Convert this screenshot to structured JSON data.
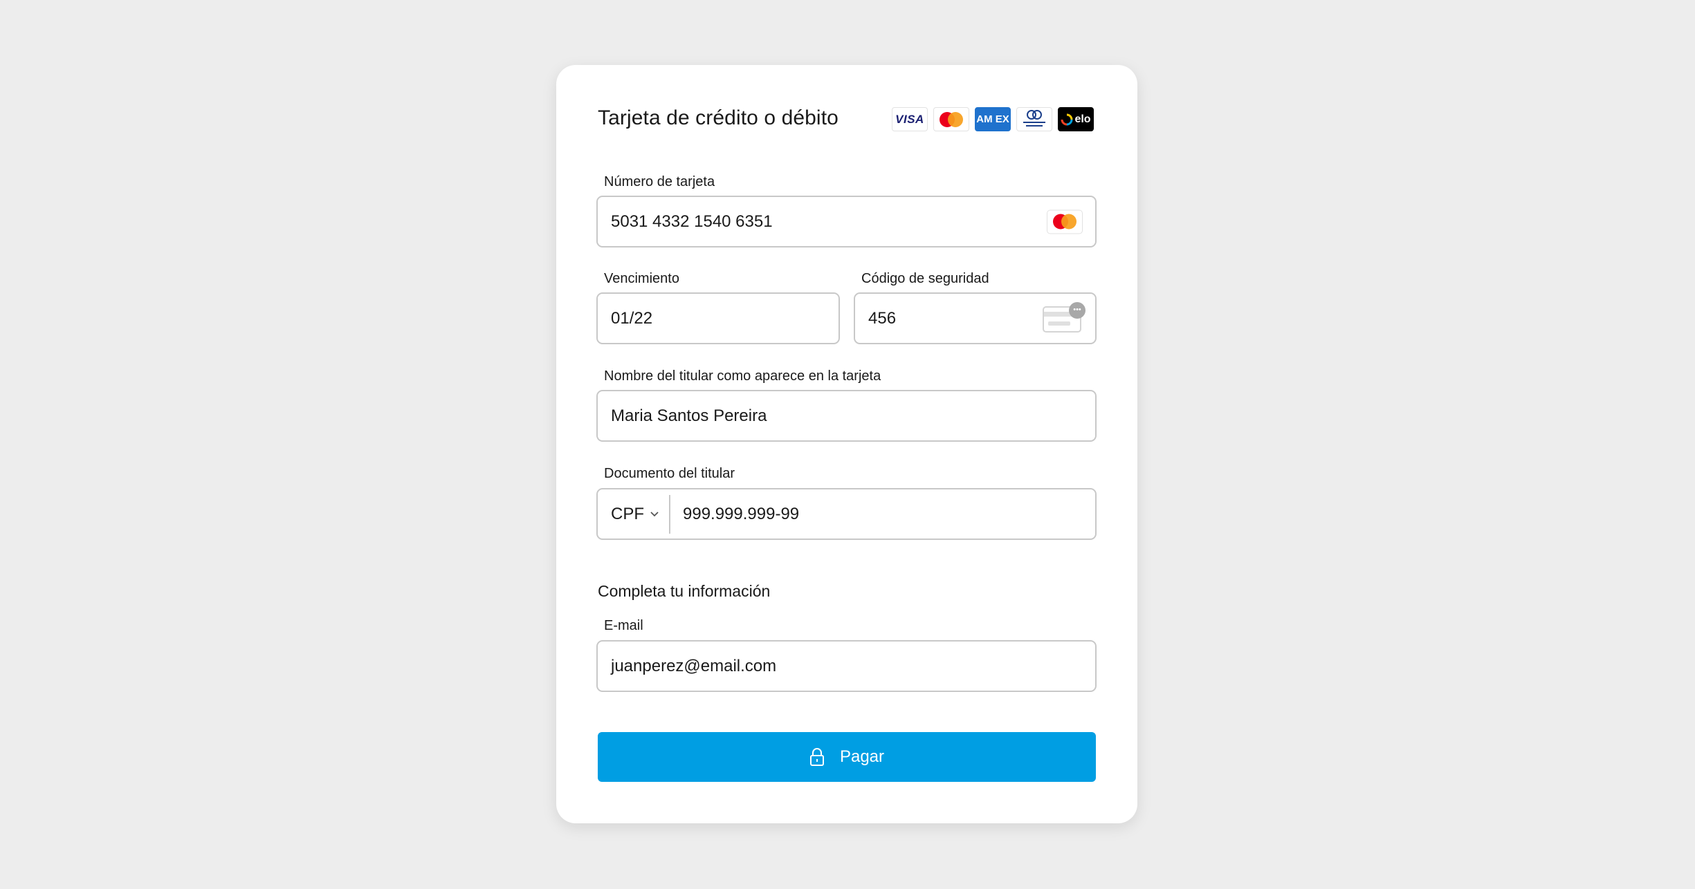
{
  "header": {
    "title": "Tarjeta de crédito o débito",
    "brands": [
      {
        "name": "visa",
        "label": "VISA"
      },
      {
        "name": "mastercard",
        "label": ""
      },
      {
        "name": "amex",
        "label": "AM EX"
      },
      {
        "name": "diners",
        "label": "Diners Club International"
      },
      {
        "name": "elo",
        "label": "elo"
      }
    ]
  },
  "form": {
    "card_number": {
      "label": "Número de tarjeta",
      "value": "5031 4332 1540 6351",
      "brand_icon": "mastercard-icon"
    },
    "expiry": {
      "label": "Vencimiento",
      "value": "01/22"
    },
    "cvv": {
      "label": "Código de seguridad",
      "value": "456",
      "icon": "card-cvv-icon"
    },
    "holder_name": {
      "label": "Nombre del titular como aparece en la tarjeta",
      "value": "Maria Santos Pereira"
    },
    "document": {
      "label": "Documento del titular",
      "type": "CPF",
      "value": "999.999.999-99"
    }
  },
  "contact": {
    "subtitle": "Completa tu información",
    "email": {
      "label": "E-mail",
      "value": "juanperez@email.com"
    }
  },
  "actions": {
    "pay_label": "Pagar",
    "pay_icon": "lock-icon"
  },
  "colors": {
    "primary": "#009ee3",
    "background": "#ededed",
    "card": "#ffffff",
    "border": "#c8c8c8"
  }
}
